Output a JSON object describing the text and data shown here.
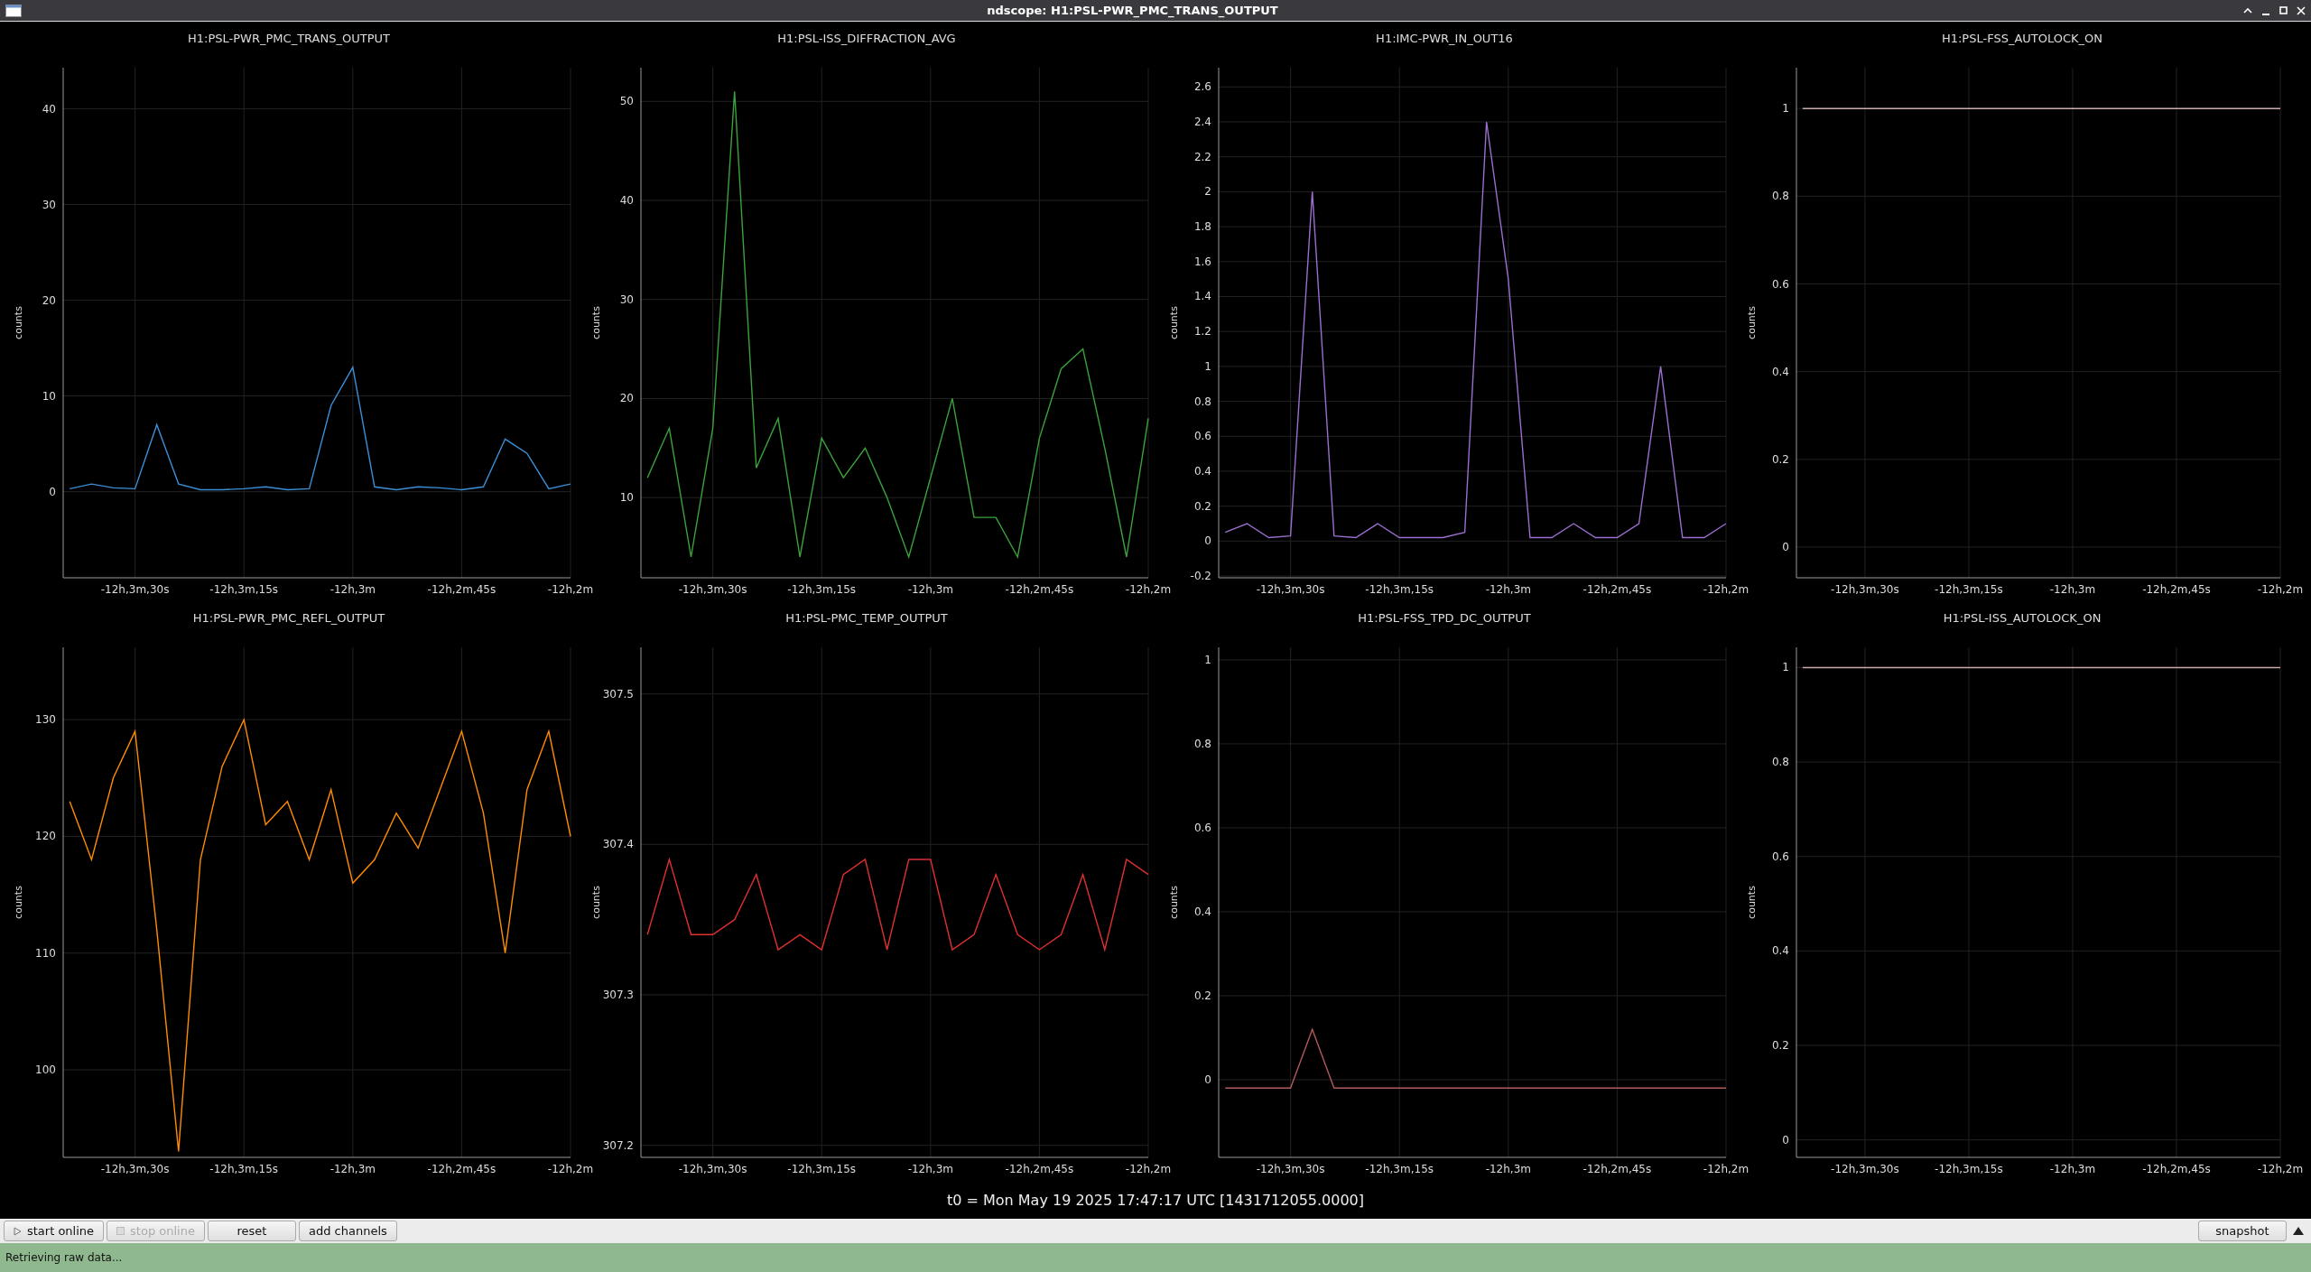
{
  "window": {
    "title": "ndscope: H1:PSL-PWR_PMC_TRANS_OUTPUT"
  },
  "plots": [
    {
      "chart_data": {
        "type": "line",
        "title": "H1:PSL-PWR_PMC_TRANS_OUTPUT",
        "grid": true,
        "ylabel": "counts",
        "categories": [
          null,
          null,
          null,
          "-12h,3m,30s",
          null,
          null,
          null,
          null,
          "-12h,3m,15s",
          null,
          null,
          null,
          null,
          "-12h,3m",
          null,
          null,
          null,
          null,
          "-12h,2m,45s",
          null,
          null,
          null,
          null,
          "-12h,2m"
        ],
        "ylim": [
          -9,
          44.3
        ],
        "yticks": [
          0,
          10,
          20,
          30,
          40
        ],
        "series": [
          {
            "color": "#3b8fd6",
            "values": [
              0.3,
              0.8,
              0.4,
              0.3,
              7,
              0.8,
              0.2,
              0.2,
              0.3,
              0.5,
              0.2,
              0.3,
              9,
              13,
              0.5,
              0.2,
              0.5,
              0.4,
              0.2,
              0.5,
              5.5,
              4,
              0.3,
              0.8
            ]
          }
        ]
      }
    },
    {
      "chart_data": {
        "type": "line",
        "title": "H1:PSL-ISS_DIFFRACTION_AVG",
        "grid": true,
        "ylabel": "counts",
        "categories": [
          null,
          null,
          null,
          "-12h,3m,30s",
          null,
          null,
          null,
          null,
          "-12h,3m,15s",
          null,
          null,
          null,
          null,
          "-12h,3m",
          null,
          null,
          null,
          null,
          "-12h,2m,45s",
          null,
          null,
          null,
          null,
          "-12h,2m"
        ],
        "ylim": [
          1.9,
          53.4
        ],
        "yticks": [
          10,
          20,
          30,
          40,
          50
        ],
        "series": [
          {
            "color": "#3aa33a",
            "values": [
              12,
              17,
              4,
              17,
              51,
              13,
              18,
              4,
              16,
              12,
              15,
              10,
              4,
              12,
              20,
              8,
              8,
              4,
              16,
              23,
              25,
              15,
              4,
              18
            ]
          }
        ]
      }
    },
    {
      "chart_data": {
        "type": "line",
        "title": "H1:IMC-PWR_IN_OUT16",
        "grid": true,
        "ylabel": "counts",
        "categories": [
          null,
          null,
          null,
          "-12h,3m,30s",
          null,
          null,
          null,
          null,
          "-12h,3m,15s",
          null,
          null,
          null,
          null,
          "-12h,3m",
          null,
          null,
          null,
          null,
          "-12h,2m,45s",
          null,
          null,
          null,
          null,
          "-12h,2m"
        ],
        "ylim": [
          -0.21,
          2.71
        ],
        "yticks": [
          -0.2,
          0,
          0.2,
          0.4,
          0.6,
          0.8,
          1,
          1.2,
          1.4,
          1.6,
          1.8,
          2,
          2.2,
          2.4,
          2.6
        ],
        "series": [
          {
            "color": "#9b6fd0",
            "values": [
              0.05,
              0.1,
              0.02,
              0.03,
              2.0,
              0.03,
              0.02,
              0.1,
              0.02,
              0.02,
              0.02,
              0.05,
              2.4,
              1.5,
              0.02,
              0.02,
              0.1,
              0.02,
              0.02,
              0.1,
              1.0,
              0.02,
              0.02,
              0.1
            ]
          }
        ]
      }
    },
    {
      "chart_data": {
        "type": "line",
        "title": "H1:PSL-FSS_AUTOLOCK_ON",
        "grid": true,
        "ylabel": "counts",
        "categories": [
          null,
          null,
          null,
          "-12h,3m,30s",
          null,
          null,
          null,
          null,
          "-12h,3m,15s",
          null,
          null,
          null,
          null,
          "-12h,3m",
          null,
          null,
          null,
          null,
          "-12h,2m,45s",
          null,
          null,
          null,
          null,
          "-12h,2m"
        ],
        "ylim": [
          -0.07,
          1.093
        ],
        "yticks": [
          0,
          0.2,
          0.4,
          0.6,
          0.8,
          1
        ],
        "series": [
          {
            "color": "#c9a9a9",
            "values": [
              1,
              1,
              1,
              1,
              1,
              1,
              1,
              1,
              1,
              1,
              1,
              1,
              1,
              1,
              1,
              1,
              1,
              1,
              1,
              1,
              1,
              1,
              1,
              1
            ]
          }
        ]
      }
    },
    {
      "chart_data": {
        "type": "line",
        "title": "H1:PSL-PWR_PMC_REFL_OUTPUT",
        "grid": true,
        "ylabel": "counts",
        "categories": [
          null,
          null,
          null,
          "-12h,3m,30s",
          null,
          null,
          null,
          null,
          "-12h,3m,15s",
          null,
          null,
          null,
          null,
          "-12h,3m",
          null,
          null,
          null,
          null,
          "-12h,2m,45s",
          null,
          null,
          null,
          null,
          "-12h,2m"
        ],
        "ylim": [
          92.5,
          136.2
        ],
        "yticks": [
          100,
          110,
          120,
          130
        ],
        "series": [
          {
            "color": "#ff8c00",
            "values": [
              123,
              118,
              125,
              129,
              112,
              93,
              118,
              126,
              130,
              121,
              123,
              118,
              124,
              116,
              118,
              122,
              119,
              124,
              129,
              122,
              110,
              124,
              129,
              120
            ]
          }
        ]
      }
    },
    {
      "chart_data": {
        "type": "line",
        "title": "H1:PSL-PMC_TEMP_OUTPUT",
        "grid": true,
        "ylabel": "counts",
        "categories": [
          null,
          null,
          null,
          "-12h,3m,30s",
          null,
          null,
          null,
          null,
          "-12h,3m,15s",
          null,
          null,
          null,
          null,
          "-12h,3m",
          null,
          null,
          null,
          null,
          "-12h,2m,45s",
          null,
          null,
          null,
          null,
          "-12h,2m"
        ],
        "ylim": [
          307.192,
          307.531
        ],
        "yticks": [
          307.2,
          307.3,
          307.4,
          307.5
        ],
        "series": [
          {
            "color": "#e03030",
            "values": [
              307.34,
              307.39,
              307.34,
              307.34,
              307.35,
              307.38,
              307.33,
              307.34,
              307.33,
              307.38,
              307.39,
              307.33,
              307.39,
              307.39,
              307.33,
              307.34,
              307.38,
              307.34,
              307.33,
              307.34,
              307.38,
              307.33,
              307.39,
              307.38
            ]
          }
        ]
      }
    },
    {
      "chart_data": {
        "type": "line",
        "title": "H1:PSL-FSS_TPD_DC_OUTPUT",
        "grid": true,
        "ylabel": "counts",
        "categories": [
          null,
          null,
          null,
          "-12h,3m,30s",
          null,
          null,
          null,
          null,
          "-12h,3m,15s",
          null,
          null,
          null,
          null,
          "-12h,3m",
          null,
          null,
          null,
          null,
          "-12h,2m,45s",
          null,
          null,
          null,
          null,
          "-12h,2m"
        ],
        "ylim": [
          -0.185,
          1.03
        ],
        "yticks": [
          0,
          0.2,
          0.4,
          0.6,
          0.8,
          1
        ],
        "series": [
          {
            "color": "#b05a5a",
            "values": [
              -0.02,
              -0.02,
              -0.02,
              -0.02,
              0.12,
              -0.02,
              -0.02,
              -0.02,
              -0.02,
              -0.02,
              -0.02,
              -0.02,
              -0.02,
              -0.02,
              -0.02,
              -0.02,
              -0.02,
              -0.02,
              -0.02,
              -0.02,
              -0.02,
              -0.02,
              -0.02,
              -0.02
            ]
          }
        ]
      }
    },
    {
      "chart_data": {
        "type": "line",
        "title": "H1:PSL-ISS_AUTOLOCK_ON",
        "grid": true,
        "ylabel": "counts",
        "categories": [
          null,
          null,
          null,
          "-12h,3m,30s",
          null,
          null,
          null,
          null,
          "-12h,3m,15s",
          null,
          null,
          null,
          null,
          "-12h,3m",
          null,
          null,
          null,
          null,
          "-12h,2m,45s",
          null,
          null,
          null,
          null,
          "-12h,2m"
        ],
        "ylim": [
          -0.037,
          1.043
        ],
        "yticks": [
          0,
          0.2,
          0.4,
          0.6,
          0.8,
          1
        ],
        "series": [
          {
            "color": "#c9a9a9",
            "values": [
              1,
              1,
              1,
              1,
              1,
              1,
              1,
              1,
              1,
              1,
              1,
              1,
              1,
              1,
              1,
              1,
              1,
              1,
              1,
              1,
              1,
              1,
              1,
              1
            ]
          }
        ]
      }
    }
  ],
  "t0": "t0 = Mon May 19 2025 17:47:17 UTC [1431712055.0000]",
  "buttons": [
    {
      "label": "start online",
      "kind": "play",
      "disabled": false
    },
    {
      "label": "stop online",
      "kind": "stop",
      "disabled": true
    },
    {
      "label": "reset",
      "kind": "plain",
      "disabled": false
    },
    {
      "label": "add channels",
      "kind": "plain",
      "disabled": false
    }
  ],
  "snapshot_button": "snapshot",
  "status_bar": "Retrieving raw data..."
}
